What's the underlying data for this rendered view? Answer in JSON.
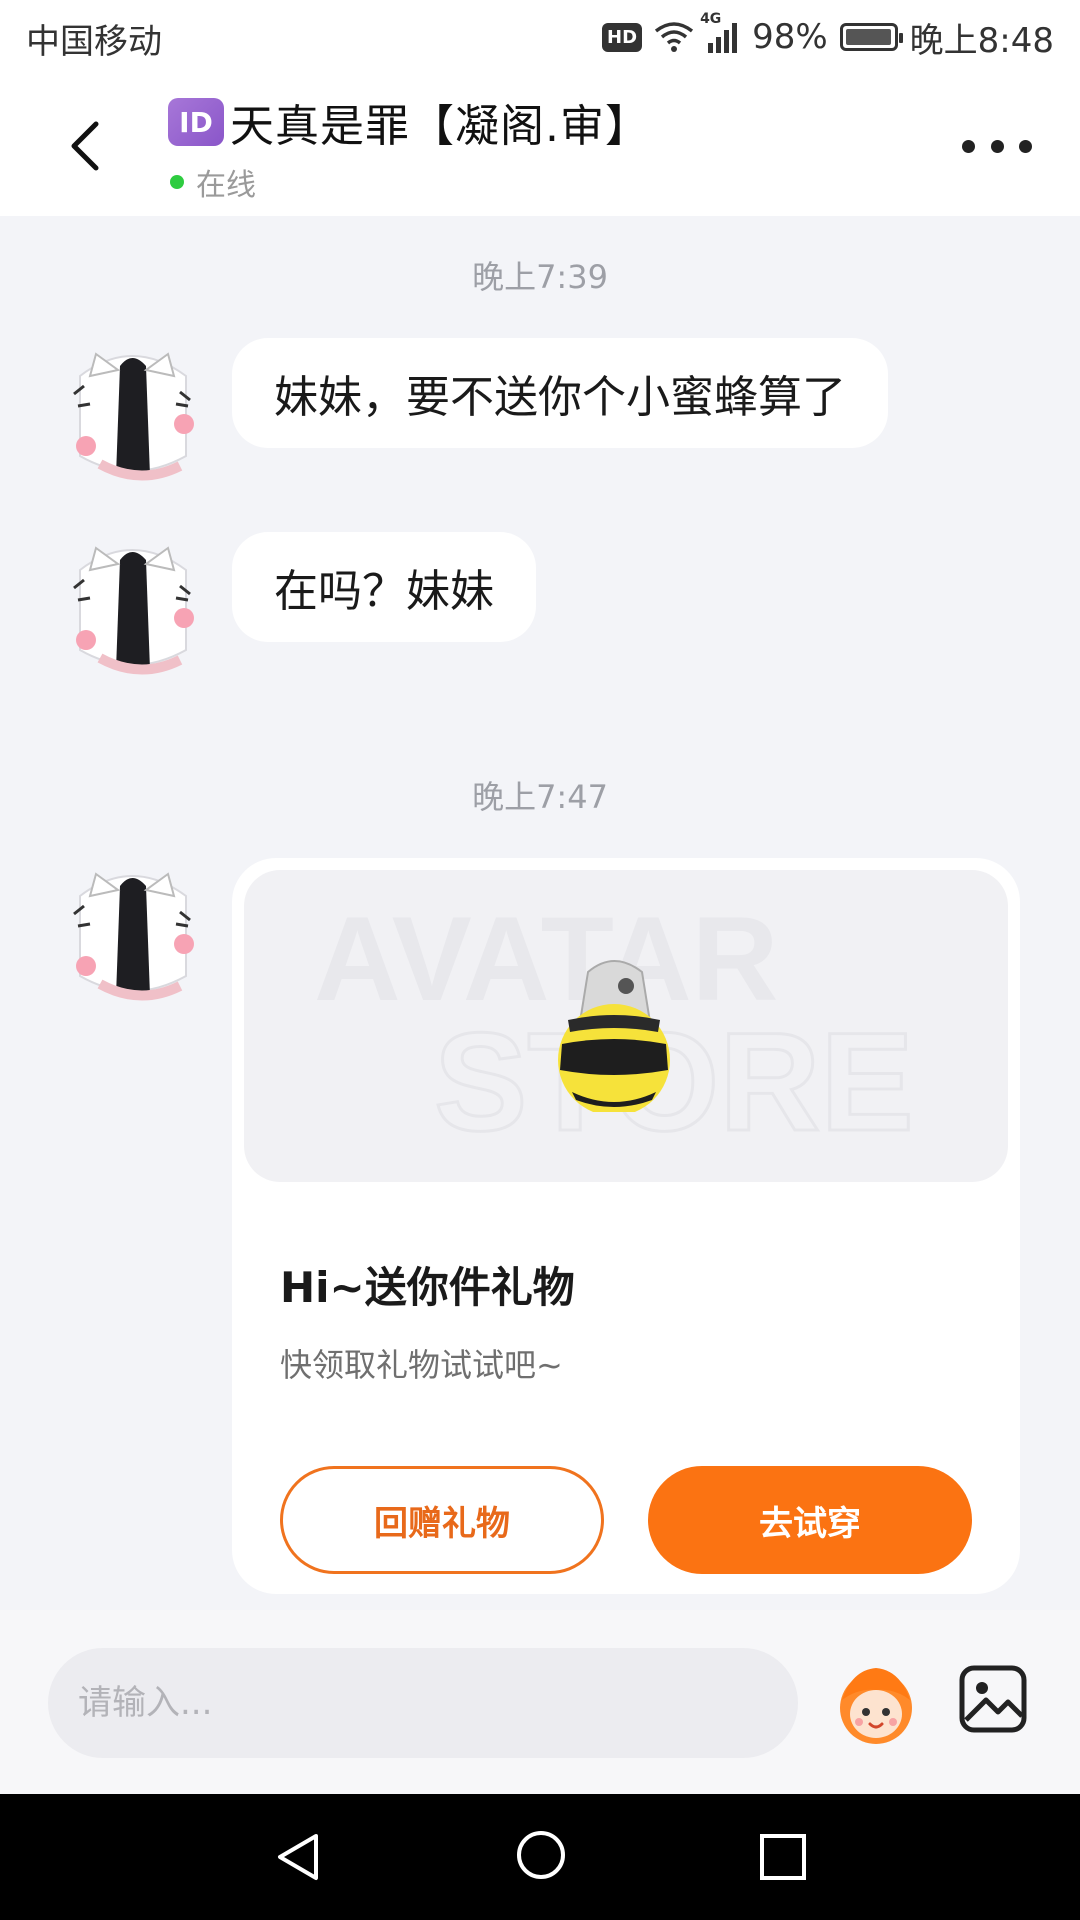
{
  "status_bar": {
    "carrier": "中国移动",
    "hd": "HD",
    "network": "4G",
    "battery": "98%",
    "time": "晚上8:48"
  },
  "header": {
    "id_badge": "ID",
    "title": "天真是罪【凝阁.审】",
    "status": "在线"
  },
  "chat": {
    "timestamps": [
      "晚上7:39",
      "晚上7:47"
    ],
    "messages": [
      {
        "text": "妹妹，要不送你个小蜜蜂算了"
      },
      {
        "text": "在吗？妹妹"
      }
    ],
    "gift_card": {
      "watermark_line1": "AVATAR",
      "watermark_line2": "STORE",
      "title": "Hi~送你件礼物",
      "subtitle": "快领取礼物试试吧~",
      "return_label": "回赠礼物",
      "try_label": "去试穿"
    }
  },
  "input_bar": {
    "placeholder": "请输入...",
    "emoji_icon": "emoji-mascot-icon",
    "image_icon": "image-icon"
  },
  "colors": {
    "accent": "#fb7312",
    "online": "#2ecc40",
    "chat_bg": "#f3f4f8"
  }
}
